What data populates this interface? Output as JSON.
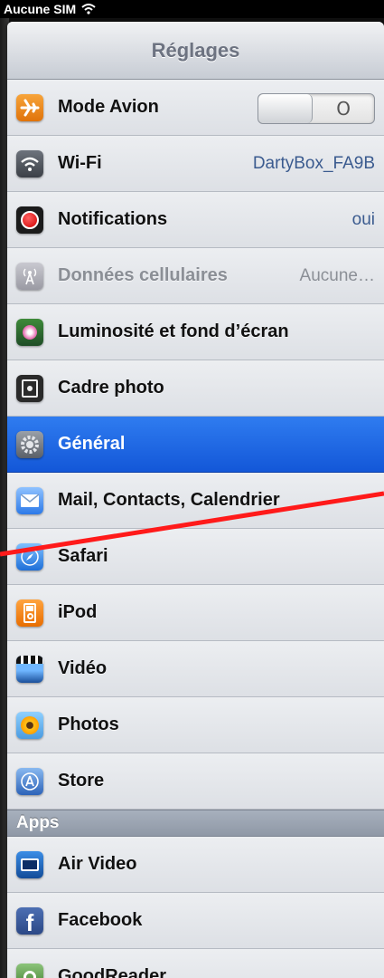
{
  "status_bar": {
    "carrier": "Aucune SIM"
  },
  "nav": {
    "title": "Réglages"
  },
  "rows": [
    {
      "label": "Mode Avion",
      "toggle_off_glyph": "O",
      "icon": "airplane-icon"
    },
    {
      "label": "Wi-Fi",
      "value": "DartyBox_FA9B",
      "icon": "wifi-icon"
    },
    {
      "label": "Notifications",
      "value": "oui",
      "icon": "notifications-icon"
    },
    {
      "label": "Données cellulaires",
      "value": "Aucune…",
      "icon": "cellular-icon"
    },
    {
      "label": "Luminosité et fond d’écran",
      "icon": "brightness-icon"
    },
    {
      "label": "Cadre photo",
      "icon": "photo-frame-icon"
    },
    {
      "label": "Général",
      "icon": "general-gear-icon"
    },
    {
      "label": "Mail, Contacts, Calendrier",
      "icon": "mail-icon"
    },
    {
      "label": "Safari",
      "icon": "safari-icon"
    },
    {
      "label": "iPod",
      "icon": "ipod-icon"
    },
    {
      "label": "Vidéo",
      "icon": "video-icon"
    },
    {
      "label": "Photos",
      "icon": "photos-icon"
    },
    {
      "label": "Store",
      "icon": "store-icon"
    }
  ],
  "apps_section": {
    "header": "Apps",
    "rows": [
      {
        "label": "Air Video",
        "icon": "air-video-icon"
      },
      {
        "label": "Facebook",
        "icon": "facebook-icon"
      },
      {
        "label": "GoodReader",
        "icon": "goodreader-icon"
      }
    ]
  },
  "colors": {
    "selected_row": "#1a62e4",
    "annotation_line": "#ff0000",
    "value_text": "#3b5b8f"
  }
}
